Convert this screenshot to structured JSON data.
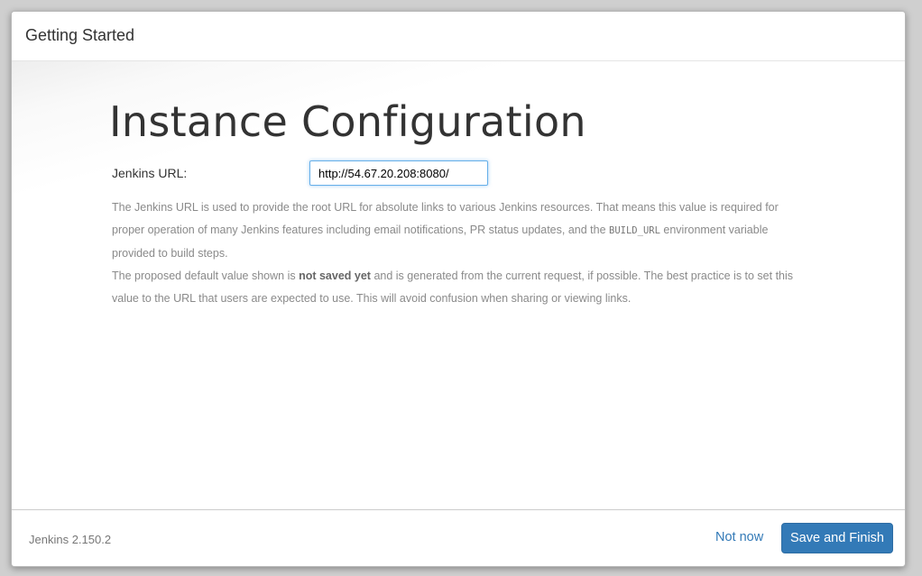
{
  "dialog": {
    "title": "Getting Started"
  },
  "main": {
    "heading": "Instance Configuration",
    "url_label": "Jenkins URL:",
    "url_value": "http://54.67.20.208:8080/",
    "help": {
      "p1_before": "The Jenkins URL is used to provide the root URL for absolute links to various Jenkins resources. That means this value is required for proper operation of many Jenkins features including email notifications, PR status updates, and the ",
      "p1_code": "BUILD_URL",
      "p1_after": " environment variable provided to build steps.",
      "p2_before": "The proposed default value shown is ",
      "p2_strong": "not saved yet",
      "p2_after": " and is generated from the current request, if possible. The best practice is to set this value to the URL that users are expected to use. This will avoid confusion when sharing or viewing links."
    }
  },
  "footer": {
    "version": "Jenkins 2.150.2",
    "not_now_label": "Not now",
    "save_label": "Save and Finish"
  },
  "colors": {
    "primary": "#337ab7",
    "text": "#333333",
    "muted": "#8a8a8a"
  }
}
